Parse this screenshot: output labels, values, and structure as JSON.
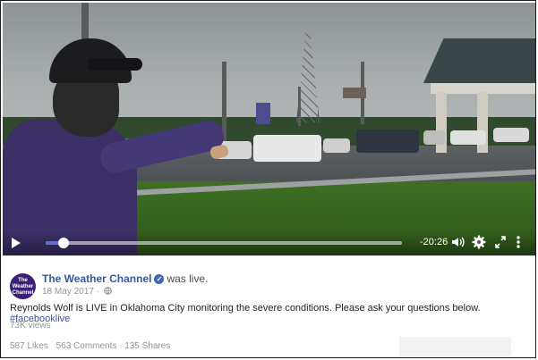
{
  "player": {
    "time_remaining": "-20:26",
    "progress": 0.05,
    "icons": {
      "play": "play-icon",
      "volume": "volume-icon",
      "settings": "gear-icon",
      "fullscreen": "expand-icon",
      "more": "more-vertical-icon"
    }
  },
  "post": {
    "avatar_text": [
      "The",
      "Weather",
      "Channel"
    ],
    "page_name": "The Weather Channel",
    "status": "was live.",
    "date": "18 May 2017 ·",
    "text": "Reynolds Wolf is LIVE in Oklahoma City monitoring the severe conditions. Please ask your questions below.",
    "hashtag": "#facebooklive",
    "views": "73K views",
    "likes": "587 Likes",
    "comments": "563 Comments",
    "shares": "135 Shares"
  },
  "colors": {
    "link": "#365899",
    "progress": "#5b6fd6",
    "avatar": "#3a1f7a"
  }
}
